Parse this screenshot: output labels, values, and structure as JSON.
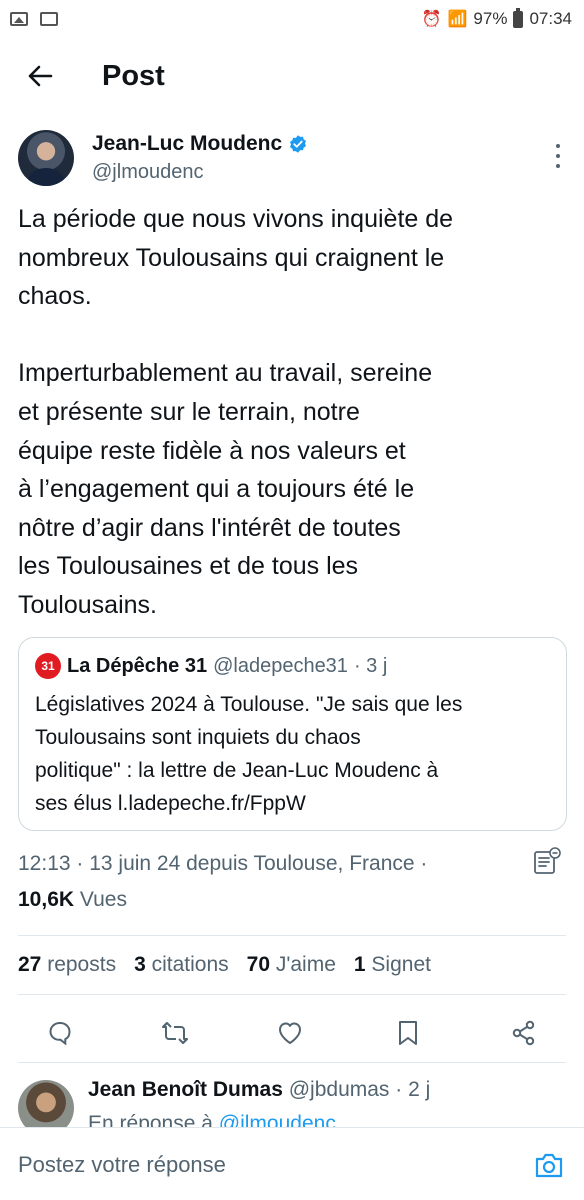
{
  "status_bar": {
    "battery": "97%",
    "time": "07:34"
  },
  "header": {
    "title": "Post"
  },
  "author": {
    "name": "Jean-Luc Moudenc",
    "handle": "@jlmoudenc"
  },
  "tweet": {
    "text": "La période que nous vivons inquiète de\nnombreux Toulousains qui craignent le\nchaos.\n\nImperturbablement au travail, sereine\net présente sur le terrain, notre\néquipe reste fidèle à nos valeurs et\nà l’engagement qui a toujours été le\nnôtre d’agir dans l'intérêt de toutes\nles Toulousaines et de tous les\nToulousains."
  },
  "quote": {
    "logo_text": "31",
    "name": "La Dépêche 31",
    "handle": "@ladepeche31",
    "time": "· 3 j",
    "text": "Législatives 2024 à Toulouse. \"Je sais que les\nToulousains sont inquiets du chaos\npolitique\" : la lettre de Jean-Luc Moudenc à\nses élus l.ladepeche.fr/FppW"
  },
  "meta": {
    "line": "12:13 · 13 juin 24 depuis Toulouse, France ·",
    "views_count": "10,6K",
    "views_label": "Vues"
  },
  "stats": [
    {
      "count": "27",
      "label": "reposts"
    },
    {
      "count": "3",
      "label": "citations"
    },
    {
      "count": "70",
      "label": "J'aime"
    },
    {
      "count": "1",
      "label": "Signet"
    }
  ],
  "reply": {
    "name": "Jean Benoît Dumas",
    "handle": "@jbdumas",
    "time": "· 2 j",
    "replying_prefix": "En réponse à",
    "replying_to": "@jlmoudenc"
  },
  "composer": {
    "placeholder": "Postez votre réponse"
  },
  "colors": {
    "accent": "#1d9bf0",
    "secondary_text": "#536471",
    "brand_red": "#e11b22"
  }
}
